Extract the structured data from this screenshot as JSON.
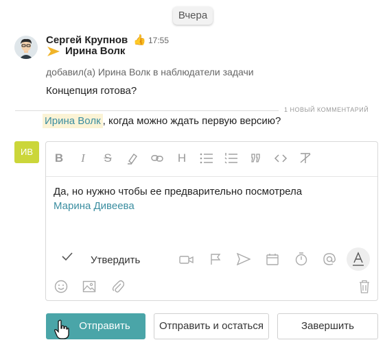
{
  "date_label": "Вчера",
  "message": {
    "author": "Сергей Крупнов",
    "time": "17:55",
    "assignee": "Ирина Волк",
    "action": "добавил(а) Ирина Волк в наблюдатели задачи",
    "text": "Концепция готова?"
  },
  "new_comments_label": "1 НОВЫЙ КОММЕНТАРИЙ",
  "new_comment": {
    "mention": "Ирина Волк",
    "text": ", когда можно ждать первую версию?"
  },
  "current_user_initials": "ИВ",
  "editor": {
    "text": "Да, но нужно чтобы ее предварительно посмотрела",
    "mention": "Марина Дивеева",
    "confirm_label": "Утвердить"
  },
  "buttons": {
    "send": "Отправить",
    "send_stay": "Отправить и остаться",
    "finish": "Завершить"
  },
  "colors": {
    "accent": "#4aa5a8",
    "mention_bg": "#fbf3d5",
    "mention_text": "#3a8da0",
    "avatar_bg": "#cbd63a"
  }
}
